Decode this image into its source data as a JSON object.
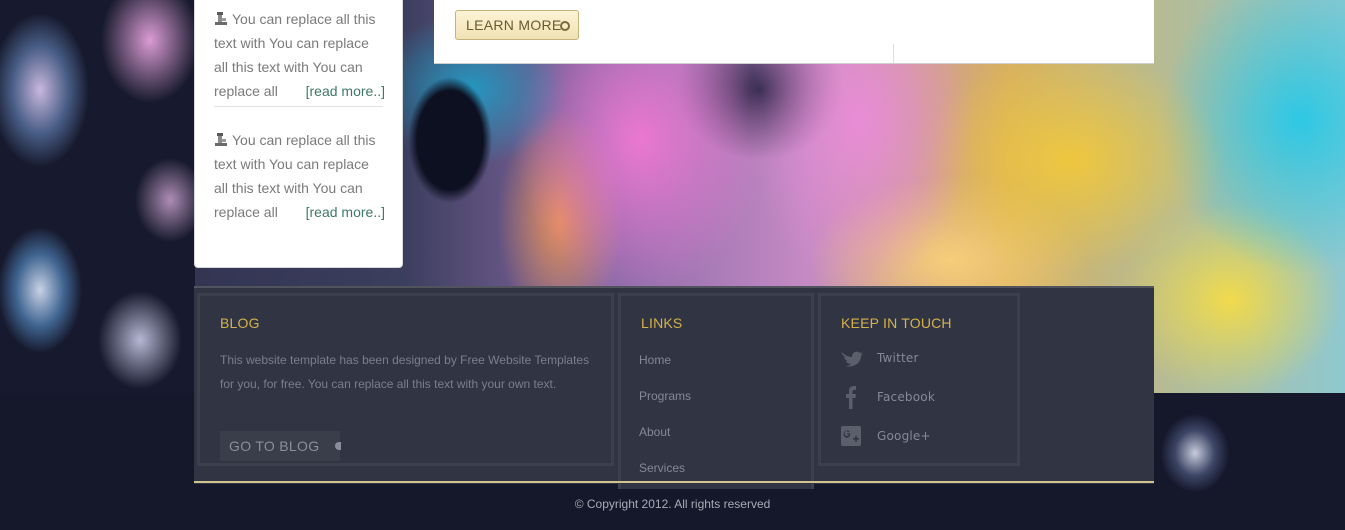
{
  "content": {
    "learn_more_label": "LEARN MORE"
  },
  "sidebar": {
    "posts": [
      {
        "text": "You can replace all this text with You can replace all this text with You can replace all",
        "read_more": "[read more..]",
        "icon": "pin-icon"
      },
      {
        "text": "You can replace all this text with You can replace all this text with You can replace all",
        "read_more": "[read more..]",
        "icon": "pin-icon"
      }
    ]
  },
  "footer": {
    "blog": {
      "title": "BLOG",
      "text": "This website template has been designed by Free Website Templates for you, for free. You can replace all this text with your own text.",
      "button": "GO TO BLOG"
    },
    "links": {
      "title": "LINKS",
      "items": [
        "Home",
        "Programs",
        "About",
        "Services"
      ]
    },
    "keep_in_touch": {
      "title": "KEEP IN TOUCH",
      "items": [
        {
          "label": "Twitter",
          "icon": "twitter-icon"
        },
        {
          "label": "Facebook",
          "icon": "facebook-icon"
        },
        {
          "label": "Google+",
          "icon": "google-plus-icon"
        }
      ]
    },
    "copyright": "© Copyright 2012. All rights reserved"
  },
  "colors": {
    "heading_gold": "#d5b24a",
    "footer_bg": "#313443",
    "read_more_green": "#3f7868",
    "button_cream": "#efe2b3"
  }
}
